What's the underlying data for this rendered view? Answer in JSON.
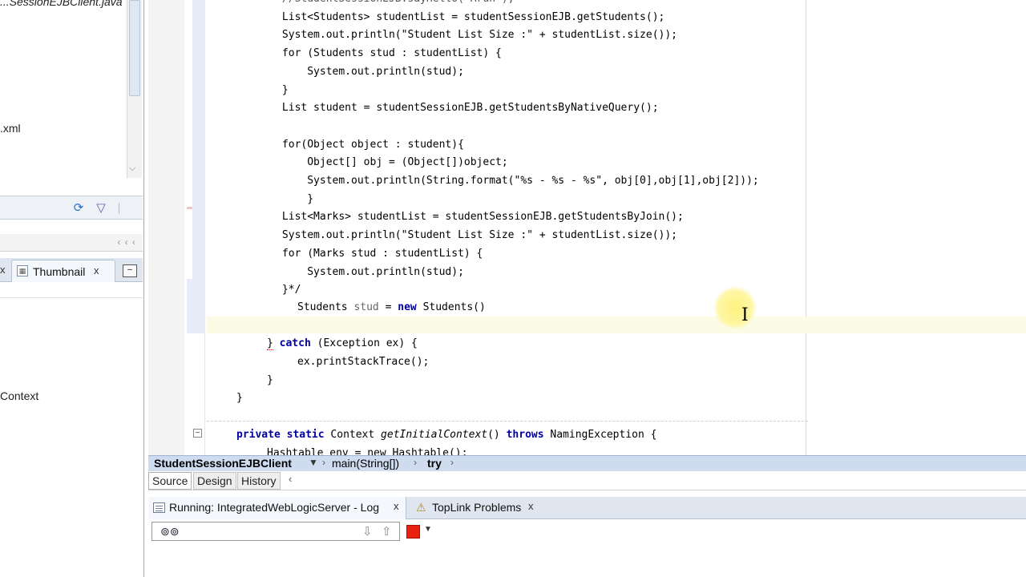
{
  "left_panel": {
    "tree_items": [
      {
        "text": "...SessionEJBClient.java"
      },
      {
        "text": ".xml"
      },
      {
        "text": "Context"
      }
    ],
    "toolbar": {
      "sync_icon": "sync-icon",
      "filter_icon": "filter-icon"
    },
    "divider_chevrons": "‹ ‹ ‹",
    "thumbnail_tab": {
      "label": "Thumbnail",
      "close": "x"
    },
    "minimize": "–"
  },
  "editor": {
    "lines": [
      {
        "text": "            //StudentSessionEJB.sayHello(\"Arun\");"
      },
      {
        "text": "            List<Students> studentList = studentSessionEJB.getStudents();"
      },
      {
        "text": "            System.out.println(\"Student List Size :\" + studentList.size());"
      },
      {
        "text": "            for (Students stud : studentList) {"
      },
      {
        "text": "                System.out.println(stud);"
      },
      {
        "text": "            }"
      },
      {
        "text": "            List student = studentSessionEJB.getStudentsByNativeQuery();"
      },
      {
        "text": ""
      },
      {
        "text": "            for(Object object : student){"
      },
      {
        "text": "                Object[] obj = (Object[])object;"
      },
      {
        "text": "                System.out.println(String.format(\"%s - %s - %s\", obj[0],obj[1],obj[2]));"
      },
      {
        "text": "                }"
      },
      {
        "text": "            List<Marks> studentList = studentSessionEJB.getStudentsByJoin();"
      },
      {
        "text": "            System.out.println(\"Student List Size :\" + studentList.size());"
      },
      {
        "text": "            for (Marks stud : studentList) {"
      },
      {
        "text": "                System.out.println(stud);"
      },
      {
        "text": "            }*/"
      }
    ],
    "line_students": {
      "type": "Students",
      "var": "stud",
      "eq": "=",
      "kw_new": "new",
      "ctor": "Students()"
    },
    "line_catch": {
      "brace": "}",
      "kw_catch": "catch",
      "rest": "(Exception ex) {"
    },
    "line_stacktrace": "ex.printStackTrace();",
    "line_close1": "}",
    "line_close2": "}",
    "line_method": {
      "kw_private": "private",
      "kw_static": "static",
      "type": "Context",
      "name": "getInitialContext",
      "parens": "()",
      "kw_throws": "throws",
      "exc": "NamingException {"
    },
    "line_hashtable": "Hashtable env = new Hashtable();"
  },
  "breadcrumb": {
    "items": [
      "StudentSessionEJBClient",
      "main(String[])",
      "try"
    ]
  },
  "editor_tabs": {
    "source": "Source",
    "design": "Design",
    "history": "History",
    "nav": "‹"
  },
  "log_panel": {
    "running_tab": {
      "label": "Running: IntegratedWebLogicServer - Log",
      "close": "x"
    },
    "toplink_tab": {
      "label": "TopLink Problems",
      "close": "x"
    },
    "search_placeholder": ""
  },
  "colors": {
    "keyword": "#0000a0",
    "breadcrumb_bg": "#cfdcf0",
    "stop": "#e8220e",
    "current_line": "#fbfbe6"
  }
}
